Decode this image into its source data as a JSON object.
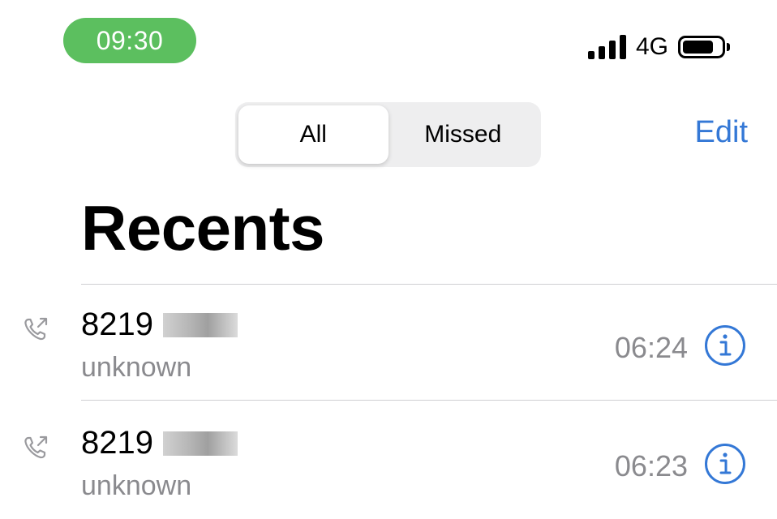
{
  "status_bar": {
    "time": "09:30",
    "network": "4G",
    "signal_bars": 4,
    "battery_level": 0.8,
    "time_pill_color": "#5cbf5f"
  },
  "header": {
    "segments": [
      {
        "label": "All",
        "active": true
      },
      {
        "label": "Missed",
        "active": false
      }
    ],
    "edit_label": "Edit"
  },
  "page": {
    "title": "Recents"
  },
  "calls": [
    {
      "number": "8219",
      "label": "unknown",
      "time": "06:24",
      "icon": "outgoing-call-icon"
    },
    {
      "number": "8219",
      "label": "unknown",
      "time": "06:23",
      "icon": "outgoing-call-icon"
    }
  ],
  "colors": {
    "accent": "#3478d6",
    "secondary_text": "#8a8a8e"
  }
}
